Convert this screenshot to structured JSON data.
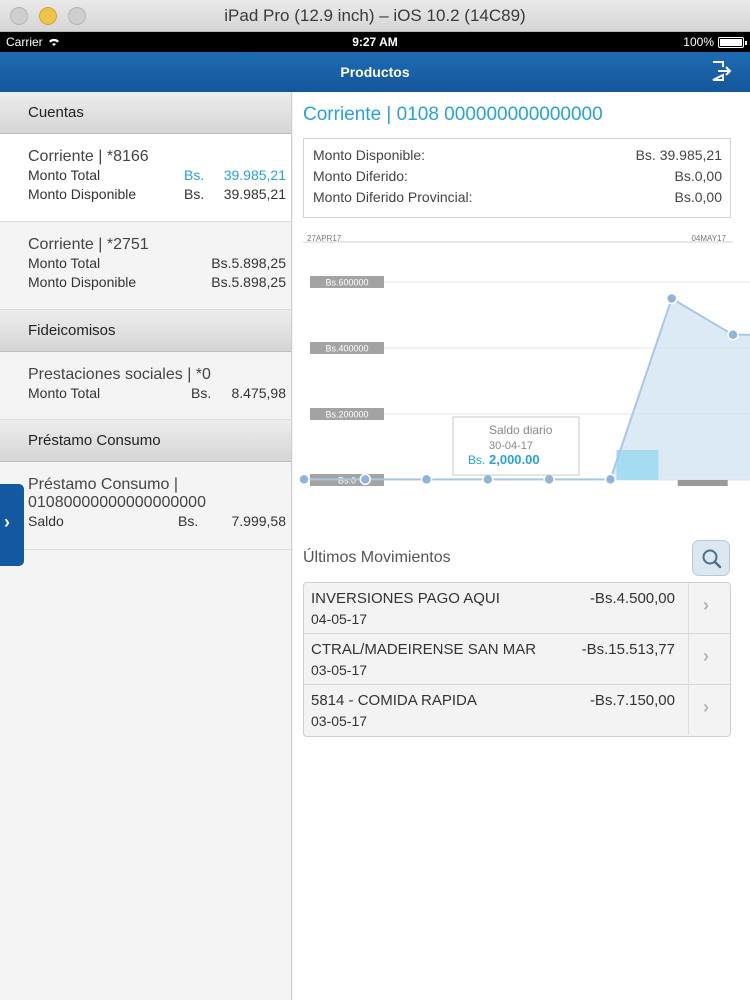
{
  "simulator": {
    "title": "iPad Pro (12.9 inch) – iOS 10.2 (14C89)"
  },
  "status_bar": {
    "carrier": "Carrier",
    "time": "9:27 AM",
    "battery": "100%"
  },
  "nav": {
    "title": "Productos",
    "logout_icon": "logout-icon"
  },
  "sidebar": {
    "sections": [
      {
        "header": "Cuentas",
        "items": [
          {
            "title": "Corriente | *8166",
            "rows": [
              {
                "label": "Monto Total",
                "currency": "Bs.",
                "amount": "39.985,21"
              },
              {
                "label": "Monto Disponible",
                "currency": "Bs.",
                "amount": "39.985,21"
              }
            ]
          },
          {
            "title": "Corriente | *2751",
            "rows": [
              {
                "label": "Monto Total",
                "currency": "",
                "amount": "Bs.5.898,25"
              },
              {
                "label": "Monto Disponible",
                "currency": "",
                "amount": "Bs.5.898,25"
              }
            ]
          }
        ]
      },
      {
        "header": "Fideicomisos",
        "items": [
          {
            "title": "Prestaciones sociales | *0",
            "rows": [
              {
                "label": "Monto Total",
                "currency": "Bs.",
                "amount": "8.475,98"
              }
            ]
          }
        ]
      },
      {
        "header": "Préstamo Consumo",
        "items": [
          {
            "title": "Préstamo Consumo |",
            "subtitle": "01080000000000000000",
            "rows": [
              {
                "label": "Saldo",
                "currency": "Bs.",
                "amount": "7.999,58"
              }
            ]
          }
        ]
      }
    ],
    "toggle_icon": "chevron-right-icon"
  },
  "detail": {
    "heading": "Corriente | 0108 000000000000000",
    "summary": [
      {
        "label": "Monto Disponible:",
        "amount": "Bs.  39.985,21"
      },
      {
        "label": "Monto Diferido:",
        "amount": "Bs.0,00"
      },
      {
        "label": "Monto Diferido Provincial:",
        "amount": "Bs.0,00"
      }
    ]
  },
  "chart_data": {
    "type": "line",
    "x_start_label": "27APR17",
    "x_end_label": "04MAY17",
    "y_tick_labels": [
      "Bs.600000",
      "Bs.400000",
      "Bs.200000",
      "Bs.0"
    ],
    "ylim": [
      0,
      600000
    ],
    "series": [
      {
        "x": [
          "27-04-17",
          "28-04-17",
          "29-04-17",
          "30-04-17",
          "01-05-17",
          "02-05-17",
          "03-05-17",
          "04-05-17"
        ],
        "values": [
          2000,
          2000,
          2000,
          2000,
          2000,
          2000,
          550000,
          440000
        ]
      }
    ],
    "tooltip": {
      "title": "Saldo diario",
      "date": "30-04-17",
      "currency": "Bs.",
      "value": "2,000.00"
    }
  },
  "movements": {
    "title": "Últimos Movimientos",
    "search_icon": "search-icon",
    "items": [
      {
        "description": "INVERSIONES PAGO AQUI",
        "amount": "-Bs.4.500,00",
        "date": "04-05-17"
      },
      {
        "description": "CTRAL/MADEIRENSE SAN MAR",
        "amount": "-Bs.15.513,77",
        "date": "03-05-17"
      },
      {
        "description": "5814 - COMIDA RAPIDA",
        "amount": "-Bs.7.150,00",
        "date": "03-05-17"
      }
    ]
  },
  "colors": {
    "nav": "#1a63ab",
    "accent": "#26a3db",
    "chart_fill": "#cfe3f0",
    "chart_point": "#8fb5dc"
  }
}
